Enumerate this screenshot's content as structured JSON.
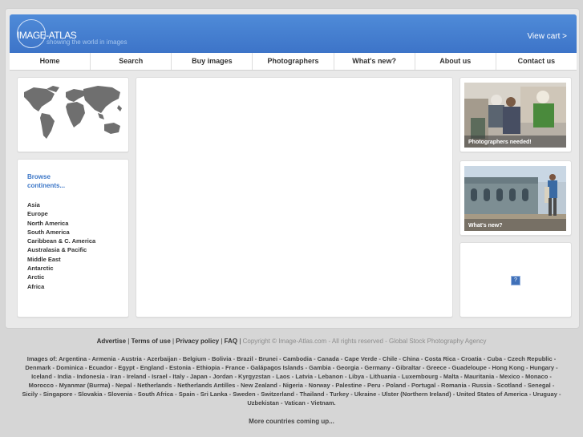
{
  "header": {
    "logo_title": "IMAGE-ATLAS",
    "logo_tagline": "showing the world in images",
    "view_cart": "View cart >"
  },
  "nav": [
    {
      "label": "Home"
    },
    {
      "label": "Search"
    },
    {
      "label": "Buy images"
    },
    {
      "label": "Photographers"
    },
    {
      "label": "What's new?"
    },
    {
      "label": "About us"
    },
    {
      "label": "Contact us"
    }
  ],
  "sidebar": {
    "browse_title_line1": "Browse",
    "browse_title_line2": "continents...",
    "continents": [
      "Asia",
      "Europe",
      "North America",
      "South America",
      "Caribbean & C. America",
      "Australasia & Pacific",
      "Middle East",
      "Antarctic",
      "Arctic",
      "Africa"
    ]
  },
  "promos": {
    "photographers_caption": "Photographers needed!",
    "whats_new_caption": "What's new?",
    "help_icon": "?"
  },
  "footer": {
    "advertise": "Advertise",
    "terms": "Terms of use",
    "privacy": "Privacy policy",
    "faq": "FAQ",
    "copyright": "Copyright © Image-Atlas.com - All rights reserved - Global Stock Photography Agency",
    "images_of": "Images of: Argentina - Armenia - Austria - Azerbaijan - Belgium - Bolivia - Brazil - Brunei - Cambodia - Canada - Cape Verde - Chile - China - Costa Rica - Croatia - Cuba - Czech Republic - Denmark - Dominica - Ecuador - Egypt - England - Estonia - Ethiopia - France - Galápagos Islands - Gambia - Georgia - Germany - Gibraltar - Greece - Guadeloupe - Hong Kong - Hungary - Iceland - India - Indonesia - Iran - Ireland - Israel - Italy - Japan - Jordan - Kyrgyzstan - Laos - Latvia - Lebanon - Libya - Lithuania - Luxembourg - Malta - Mauritania - Mexico - Monaco - Morocco - Myanmar (Burma) - Nepal - Netherlands - Netherlands Antilles - New Zealand - Nigeria - Norway - Palestine - Peru - Poland - Portugal - Romania - Russia - Scotland - Senegal - Sicily - Singapore - Slovakia - Slovenia - South Africa - Spain - Sri Lanka - Sweden - Switzerland - Thailand - Turkey - Ukraine - Ulster (Northern Ireland) - United States of America - Uruguay - Uzbekistan - Vatican - Vietnam.",
    "more": "More countries coming up..."
  }
}
